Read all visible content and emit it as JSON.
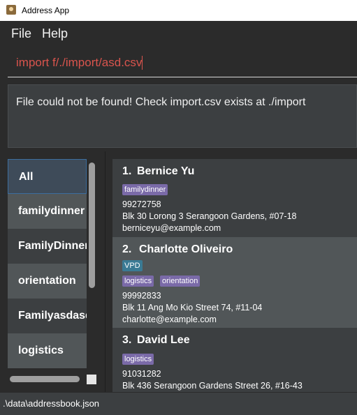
{
  "window": {
    "title": "Address App",
    "icon": "address-book-icon"
  },
  "menu": {
    "items": [
      "File",
      "Help"
    ]
  },
  "command": {
    "value": "import f/./import/asd.csv"
  },
  "result": {
    "message": "File could not be found! Check import.csv exists at ./import"
  },
  "tags": [
    "All",
    "familydinner",
    "FamilyDinner",
    "orientation",
    "Familyasdasd",
    "logistics"
  ],
  "persons": [
    {
      "index": "1.",
      "name": "Bernice Yu",
      "tags": [
        "familydinner"
      ],
      "phone": "99272758",
      "address": "Blk 30 Lorong 3 Serangoon Gardens, #07-18",
      "email": "berniceyu@example.com"
    },
    {
      "index": "2.",
      "name": "Charlotte Oliveiro",
      "special_tag": "VPD",
      "tags": [
        "logistics",
        "orientation"
      ],
      "phone": "99992833",
      "address": "Blk 11 Ang Mo Kio Street 74, #11-04",
      "email": "charlotte@example.com"
    },
    {
      "index": "3.",
      "name": "David Lee",
      "tags": [
        "logistics"
      ],
      "phone": "91031282",
      "address": "Blk 436 Serangoon Gardens Street 26, #16-43"
    }
  ],
  "status": {
    "path": ".\\data\\addressbook.json"
  },
  "colors": {
    "tag_purple": "#7a6aa8",
    "tag_teal": "#3a7a94",
    "error_text": "#d9544d"
  }
}
